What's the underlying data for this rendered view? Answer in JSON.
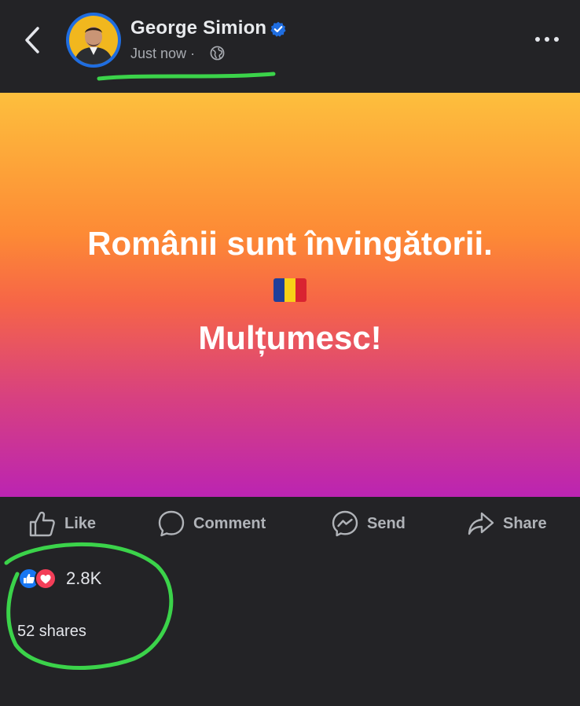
{
  "post": {
    "author": "George Simion",
    "timestamp": "Just now",
    "separator": "·",
    "audience_icon": "globe-icon",
    "verified_icon": "verified-badge-icon",
    "menu_icon": "more-options-icon"
  },
  "content": {
    "line1": "Românii sunt învingătorii.",
    "flag_icon": "romania-flag",
    "line2": "Mulțumesc!",
    "background_colors": [
      "#fdbf3d",
      "#fd8a35",
      "#f66547",
      "#d8417f",
      "#bb24b2"
    ]
  },
  "actions": {
    "like": "Like",
    "comment": "Comment",
    "send": "Send",
    "share": "Share"
  },
  "engagement": {
    "reactions_count": "2.8K",
    "shares": "52 shares"
  },
  "colors": {
    "background": "#232326",
    "accent_blue": "#1f6de0",
    "annotation_green": "#3bd34a",
    "reaction_like": "#1877f2",
    "reaction_love": "#f33e58"
  }
}
